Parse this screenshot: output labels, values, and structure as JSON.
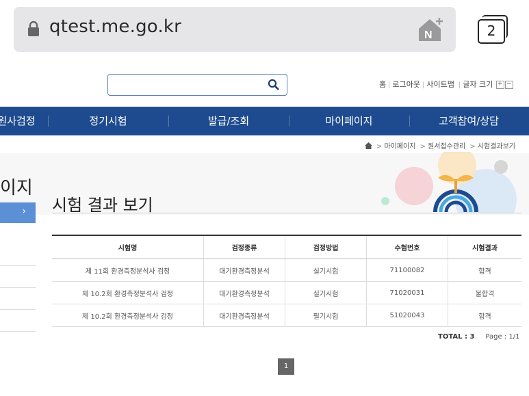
{
  "browser": {
    "url": "qtest.me.go.kr",
    "tab_count": "2"
  },
  "search": {
    "placeholder": ""
  },
  "util": {
    "home": "홈",
    "logout": "로그아웃",
    "sitemap": "사이트맵",
    "font_size": "글자 크기",
    "font_plus": "+",
    "font_minus": "−"
  },
  "gnb": {
    "items": [
      {
        "label": "원사검정"
      },
      {
        "label": "정기시험"
      },
      {
        "label": "발급/조회"
      },
      {
        "label": "마이페이지"
      },
      {
        "label": "고객참여/상담"
      }
    ]
  },
  "breadcrumb": {
    "items": [
      "마이페이지",
      "원서접수관리",
      "시험결과보기"
    ]
  },
  "sidebar": {
    "title": "이지"
  },
  "page": {
    "title": "시험 결과 보기"
  },
  "table": {
    "headers": [
      "시험명",
      "검정종류",
      "검정방법",
      "수험번호",
      "시험결과"
    ],
    "rows": [
      [
        "제 11회 환경측정분석사 검정",
        "대기환경측정분석",
        "실기시험",
        "71100082",
        "합격"
      ],
      [
        "제 10.2회 환경측정분석사 검정",
        "대기환경측정분석",
        "실기시험",
        "71020031",
        "불합격"
      ],
      [
        "제 10.2회 환경측정분석사 검정",
        "대기환경측정분석",
        "필기시험",
        "51020043",
        "합격"
      ]
    ]
  },
  "summary": {
    "total_label": "TOTAL : 3",
    "page_label": "Page : 1/1"
  },
  "pager": {
    "current": "1"
  },
  "colors": {
    "nav_bg": "#1e4b8f",
    "side_active": "#5b8fd6"
  }
}
